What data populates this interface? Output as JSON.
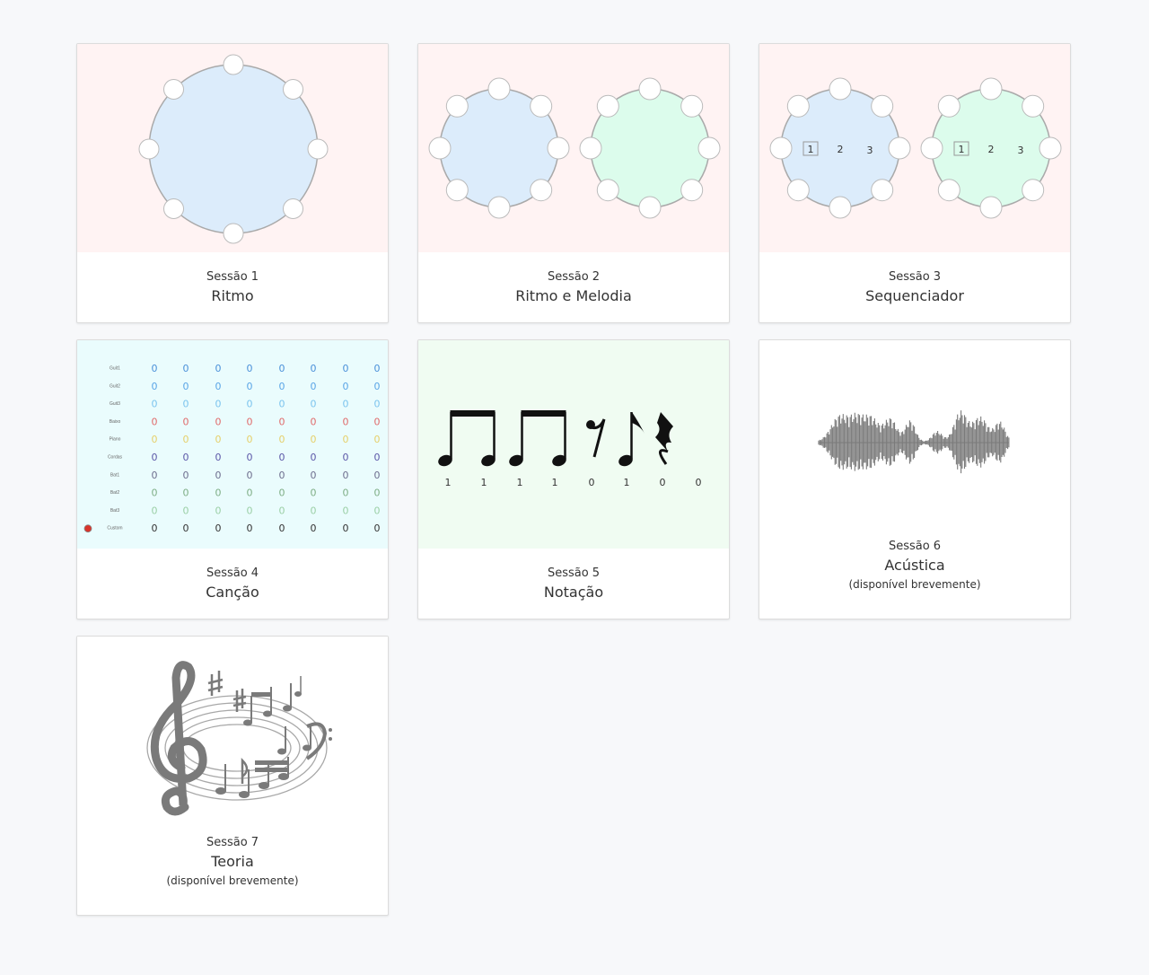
{
  "sessions": [
    {
      "number": "Sessão 1",
      "title": "Ritmo"
    },
    {
      "number": "Sessão 2",
      "title": "Ritmo e Melodia"
    },
    {
      "number": "Sessão 3",
      "title": "Sequenciador",
      "ring_labels": [
        "1",
        "2",
        "3"
      ]
    },
    {
      "number": "Sessão 4",
      "title": "Canção",
      "mixer": {
        "rows": [
          {
            "label": "Guit1",
            "color": "#4a90d9"
          },
          {
            "label": "Guit2",
            "color": "#5aa5e6"
          },
          {
            "label": "Guit3",
            "color": "#7cc4ee"
          },
          {
            "label": "Baixo",
            "color": "#e06b6b"
          },
          {
            "label": "Piano",
            "color": "#e6cf6a"
          },
          {
            "label": "Cordas",
            "color": "#5b57a8"
          },
          {
            "label": "Bat1",
            "color": "#6e6e8e"
          },
          {
            "label": "Bat2",
            "color": "#7fae86"
          },
          {
            "label": "Bat3",
            "color": "#9bcfa6"
          },
          {
            "label": "Custom",
            "color": "#333333"
          }
        ],
        "cell_value": "0",
        "record_color": "#d9342b"
      }
    },
    {
      "number": "Sessão 5",
      "title": "Notação",
      "rhythm_digits": [
        "1",
        "1",
        "1",
        "1",
        "0",
        "1",
        "0",
        "0"
      ]
    },
    {
      "number": "Sessão 6",
      "title": "Acústica",
      "note": "(disponível brevemente)"
    },
    {
      "number": "Sessão 7",
      "title": "Teoria",
      "note": "(disponível brevemente)"
    }
  ],
  "colors": {
    "ring_blue": "#dcecfb",
    "ring_green": "#dcfcec",
    "ring_stroke": "#a9a9a9",
    "thumb_pink": "#fff3f3",
    "thumb_cyan": "#eafcfd",
    "thumb_mint": "#f0fcf2"
  },
  "icons": [
    "rhythm-ring-icon",
    "dual-ring-icon",
    "sequencer-ring-icon",
    "mixer-grid-icon",
    "music-notation-icon",
    "sound-waveform-icon",
    "music-theory-icon"
  ]
}
